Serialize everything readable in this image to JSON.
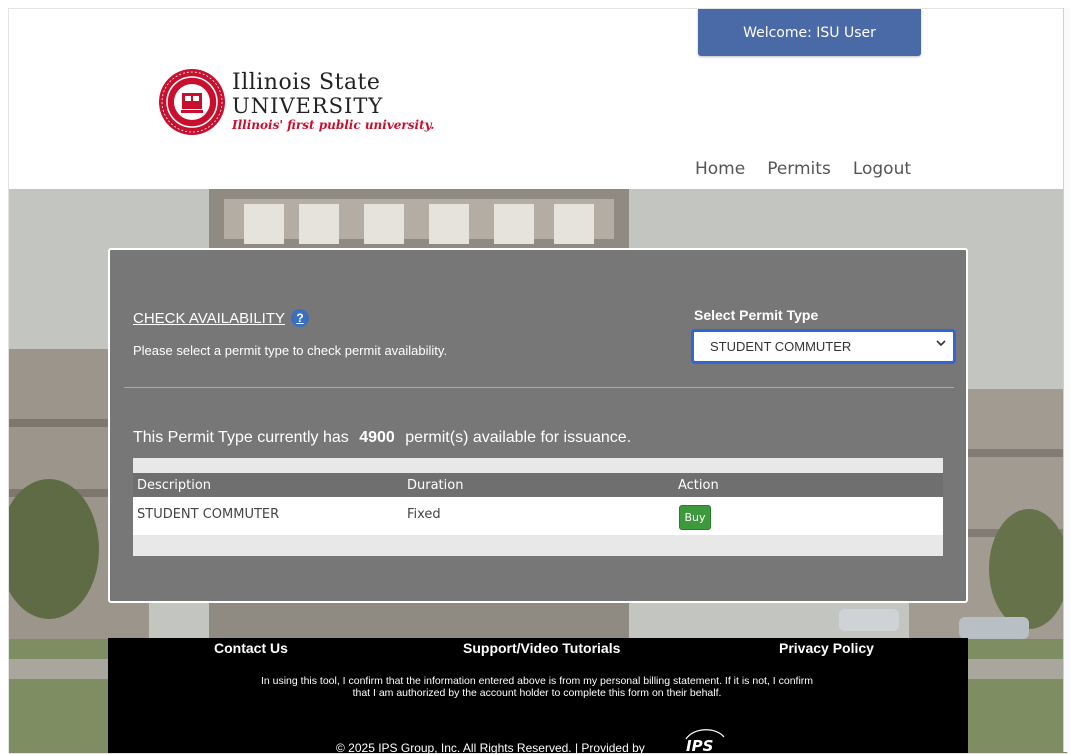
{
  "header": {
    "welcome": "Welcome: ISU User",
    "logo": {
      "line1": "Illinois State",
      "line2": "UNIVERSITY",
      "tagline": "Illinois' first public university."
    },
    "nav": [
      "Home",
      "Permits",
      "Logout"
    ]
  },
  "panel": {
    "title": "CHECK AVAILABILITY",
    "help": "?",
    "instruction": "Please select a permit type to check permit availability.",
    "select_label": "Select Permit Type",
    "select_value": "STUDENT COMMUTER",
    "availability_prefix": "This Permit Type currently has",
    "availability_count": "4900",
    "availability_suffix": "permit(s) available for issuance.",
    "table": {
      "headers": [
        "Description",
        "Duration",
        "Action"
      ],
      "rows": [
        {
          "description": "STUDENT COMMUTER",
          "duration": "Fixed",
          "action": "Buy"
        }
      ]
    }
  },
  "footer": {
    "links": [
      "Contact Us",
      "Support/Video Tutorials",
      "Privacy Policy"
    ],
    "disclaimer": "In using this tool, I confirm that the information entered above is from my personal billing statement. If it is not, I confirm that I am authorized by the account holder to complete this form on their behalf.",
    "copyright": "© 2025 IPS Group, Inc. All Rights Reserved. | Provided by",
    "provider_logo": "IPS"
  },
  "colors": {
    "welcome_bg": "#4a6aa7",
    "panel_bg": "#777777",
    "select_focus": "#2f67d8",
    "buy_button": "#3c9a3c",
    "brand_red": "#c8102e"
  }
}
